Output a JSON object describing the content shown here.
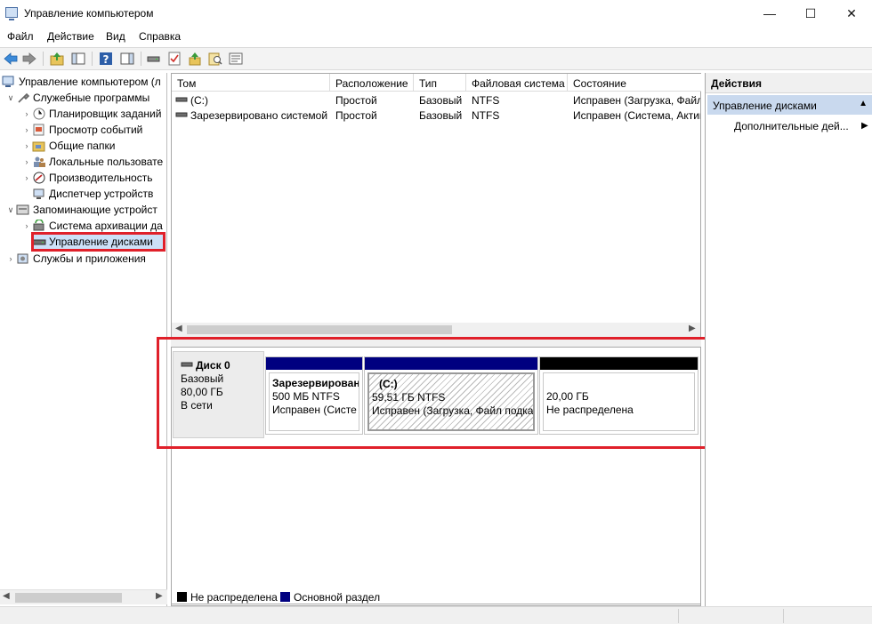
{
  "window": {
    "title": "Управление компьютером"
  },
  "menu": [
    "Файл",
    "Действие",
    "Вид",
    "Справка"
  ],
  "tree": {
    "root": "Управление компьютером (л",
    "utilities": "Служебные программы",
    "utilities_children": [
      "Планировщик заданий",
      "Просмотр событий",
      "Общие папки",
      "Локальные пользовате",
      "Производительность",
      "Диспетчер устройств"
    ],
    "storage": "Запоминающие устройст",
    "storage_children": [
      "Система архивации да",
      "Управление дисками"
    ],
    "services": "Службы и приложения"
  },
  "volumes": {
    "columns": [
      "Том",
      "Расположение",
      "Тип",
      "Файловая система",
      "Состояние"
    ],
    "rows": [
      [
        "(C:)",
        "Простой",
        "Базовый",
        "NTFS",
        "Исправен (Загрузка, Файл"
      ],
      [
        "Зарезервировано системой",
        "Простой",
        "Базовый",
        "NTFS",
        "Исправен (Система, Актив"
      ]
    ]
  },
  "disk": {
    "name": "Диск 0",
    "type": "Базовый",
    "size": "80,00 ГБ",
    "status": "В сети",
    "partitions": [
      {
        "name": "Зарезервирован",
        "size": "500 МБ NTFS",
        "state": "Исправен (Систе",
        "bar_color": "#000080"
      },
      {
        "name": "(C:)",
        "size": "59,51 ГБ NTFS",
        "state": "Исправен (Загрузка, Файл подка",
        "bar_color": "#000080"
      },
      {
        "name": "",
        "size": "20,00 ГБ",
        "state": "Не распределена",
        "bar_color": "#000000"
      }
    ]
  },
  "legend": [
    {
      "label": "Не распределена",
      "color": "#000000"
    },
    {
      "label": "Основной раздел",
      "color": "#000080"
    }
  ],
  "actions": {
    "header": "Действия",
    "section": "Управление дисками",
    "item": "Дополнительные дей..."
  },
  "accent": {
    "highlight": "#e0202a",
    "selection": "#c9d9ee"
  }
}
